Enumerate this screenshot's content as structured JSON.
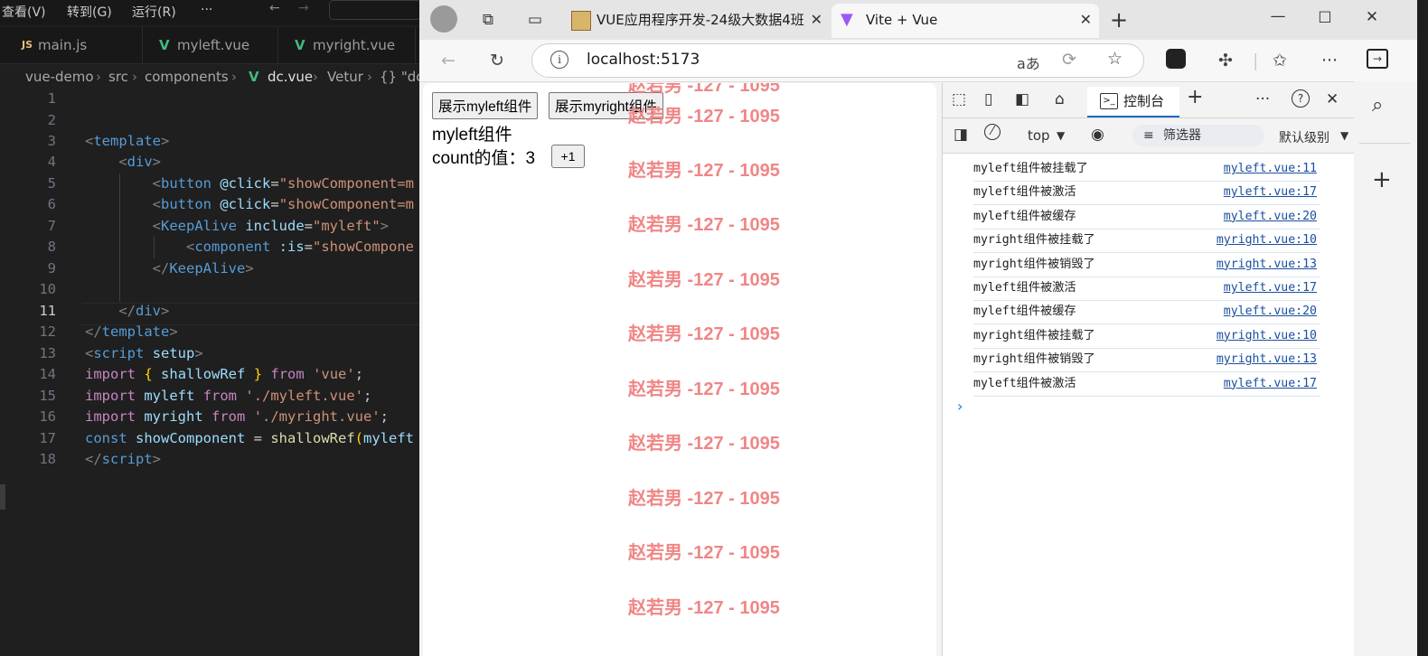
{
  "vscode": {
    "menu": [
      "查看(V)",
      "转到(G)",
      "运行(R)",
      "···"
    ],
    "tabs": [
      {
        "icon": "JS",
        "label": "main.js"
      },
      {
        "icon": "V",
        "label": "myleft.vue"
      },
      {
        "icon": "V",
        "label": "myright.vue"
      }
    ],
    "breadcrumb": [
      "vue-demo",
      "src",
      "components",
      "dc.vue",
      "Vetur",
      "{} \"dc"
    ],
    "line_numbers": [
      "1",
      "2",
      "3",
      "4",
      "5",
      "6",
      "7",
      "8",
      "9",
      "10",
      "11",
      "12",
      "13",
      "14",
      "15",
      "16",
      "17",
      "18"
    ],
    "current_line": "11"
  },
  "browser": {
    "tabs": [
      {
        "label": "VUE应用程序开发-24级大数据4班"
      },
      {
        "label": "Vite + Vue"
      }
    ],
    "url": "localhost:5173",
    "page": {
      "btn_left": "展示myleft组件",
      "btn_right": "展示myright组件",
      "component_title": "myleft组件",
      "count_label": "count的值：3",
      "inc_button": "+1",
      "watermark": "赵若男 -127 - 1095"
    },
    "devtools": {
      "console_tab": "控制台",
      "context": "top",
      "filter_placeholder": "筛选器",
      "level": "默认级别",
      "logs": [
        {
          "msg": "myleft组件被挂载了",
          "src": "myleft.vue:11"
        },
        {
          "msg": "myleft组件被激活",
          "src": "myleft.vue:17"
        },
        {
          "msg": "myleft组件被缓存",
          "src": "myleft.vue:20"
        },
        {
          "msg": "myright组件被挂载了",
          "src": "myright.vue:10"
        },
        {
          "msg": "myright组件被销毁了",
          "src": "myright.vue:13"
        },
        {
          "msg": "myleft组件被激活",
          "src": "myleft.vue:17"
        },
        {
          "msg": "myleft组件被缓存",
          "src": "myleft.vue:20"
        },
        {
          "msg": "myright组件被挂载了",
          "src": "myright.vue:10"
        },
        {
          "msg": "myright组件被销毁了",
          "src": "myright.vue:13"
        },
        {
          "msg": "myleft组件被激活",
          "src": "myleft.vue:17"
        }
      ]
    }
  }
}
